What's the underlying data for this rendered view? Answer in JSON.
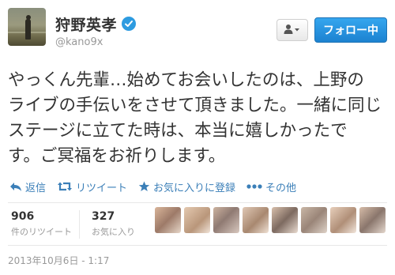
{
  "profile": {
    "fullname": "狩野英孝",
    "handle": "@kano9x",
    "verified_icon": "verified-badge-icon",
    "avatar_icon": "avatar-photo"
  },
  "buttons": {
    "user_menu_icon": "user-dropdown-icon",
    "follow_label": "フォロー中"
  },
  "tweet": {
    "lines": [
      "やっくん先輩…始めてお会いしたのは、上野の",
      "ライブの手伝いをさせて頂きました。一緒に同じ",
      "ステージに立てた時は、本当に嬉しかったで",
      "す。ご冥福をお祈りします。"
    ]
  },
  "actions": {
    "reply": "返信",
    "retweet": "リツイート",
    "favorite": "お気に入りに登録",
    "more": "その他"
  },
  "stats": {
    "retweets_count": "906",
    "retweets_label": "件のリツイート",
    "favorites_count": "327",
    "favorites_label": "お気に入り"
  },
  "footer": {
    "timestamp": "2013年10月6日 - 1:17"
  },
  "colors": {
    "link": "#3b7fb8",
    "follow_button": "#1c82d0",
    "verified": "#2d9be0"
  }
}
